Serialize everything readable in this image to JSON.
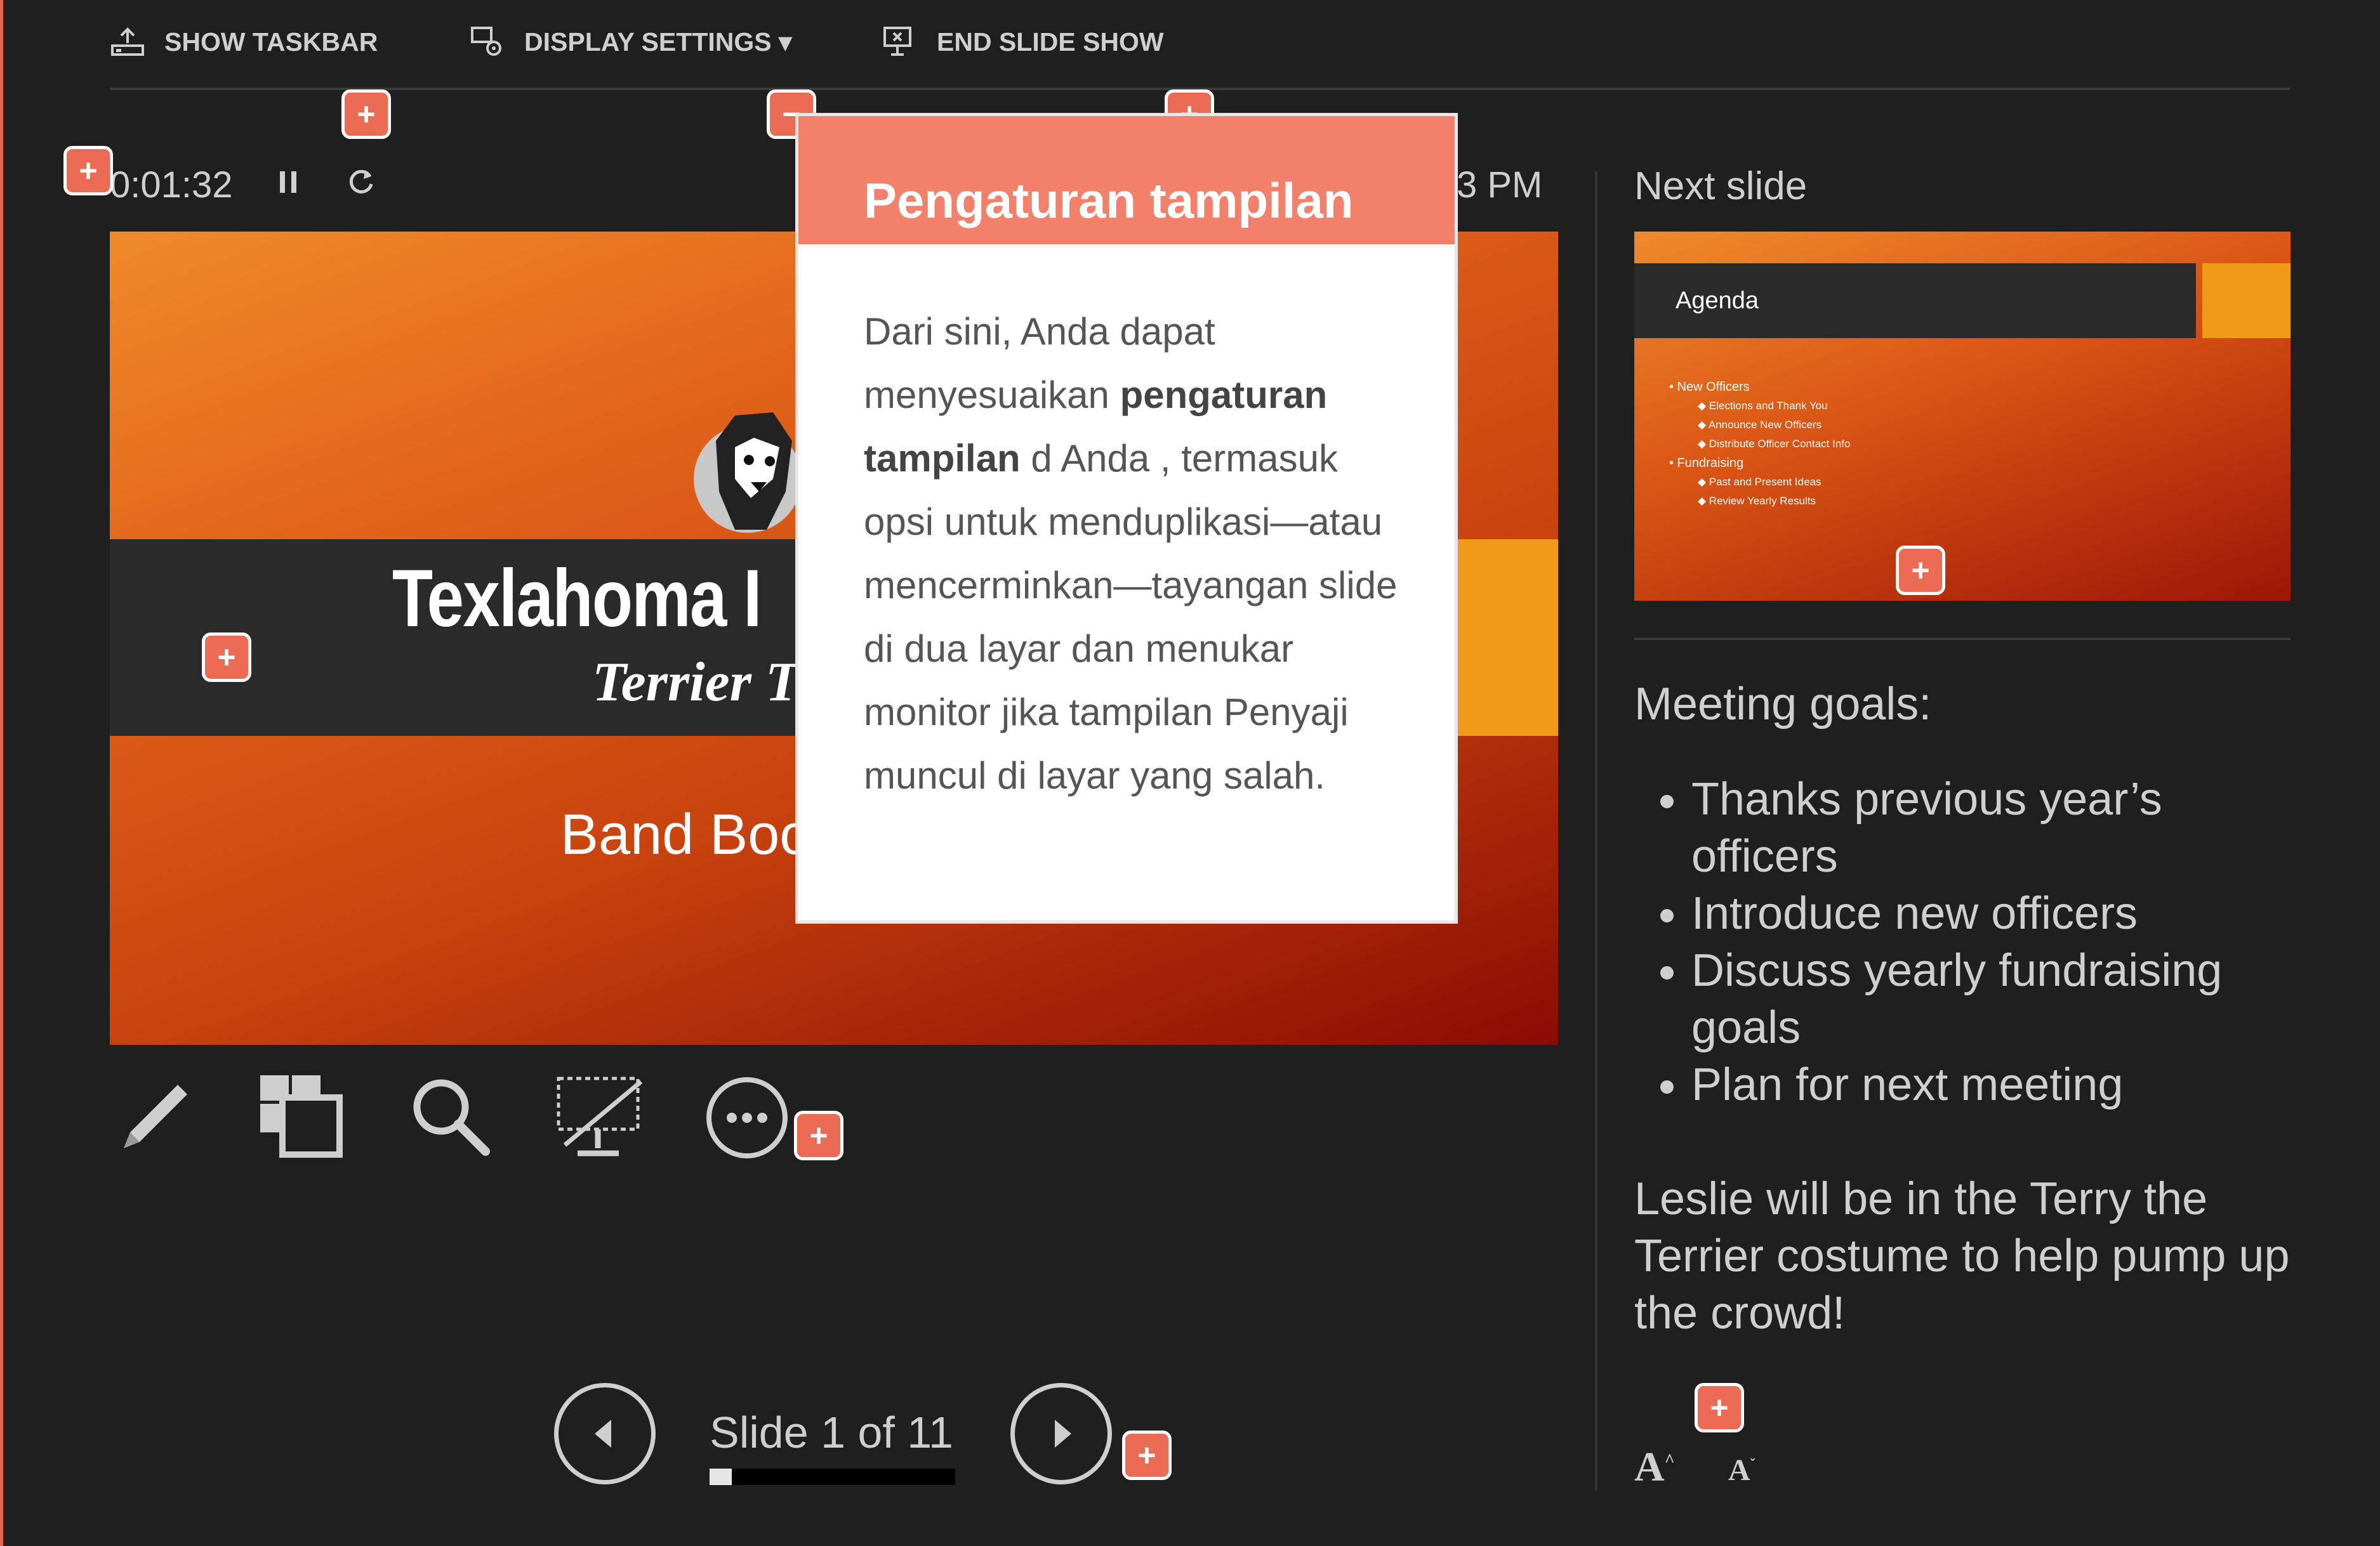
{
  "toolbar": {
    "show_taskbar": "SHOW TASKBAR",
    "display_settings": "DISPLAY SETTINGS ▾",
    "end_slide_show": "END SLIDE SHOW"
  },
  "timer": {
    "elapsed": "0:01:32",
    "clock": "3 PM"
  },
  "current_slide": {
    "title": "Texlahoma I",
    "subtitle": "Terrier T",
    "band_text": "Band Boo"
  },
  "tools": [
    "pen-icon",
    "slides-grid-icon",
    "zoom-icon",
    "black-screen-icon",
    "more-options-icon"
  ],
  "navigation": {
    "slide_label": "Slide 1 of 11",
    "progress": 0.09
  },
  "next_slide": {
    "label": "Next slide",
    "title": "Agenda",
    "bullets": [
      {
        "text": "• New Officers",
        "level": 1
      },
      {
        "text": "◆ Elections and Thank You",
        "level": 2
      },
      {
        "text": "◆ Announce New Officers",
        "level": 2
      },
      {
        "text": "◆ Distribute Officer Contact Info",
        "level": 2
      },
      {
        "text": "• Fundraising",
        "level": 1
      },
      {
        "text": "◆ Past and Present Ideas",
        "level": 2
      },
      {
        "text": "◆ Review Yearly Results",
        "level": 2
      }
    ]
  },
  "notes": {
    "heading": "Meeting goals:",
    "items": [
      "Thanks previous year’s officers",
      "Introduce new officers",
      "Discuss yearly fundraising goals",
      "Plan for next meeting"
    ],
    "closing": "Leslie will be in the Terry the Terrier costume to help pump up the crowd!"
  },
  "font_controls": {
    "increase": "A",
    "decrease": "A"
  },
  "tooltip": {
    "title": "Pengaturan tampilan",
    "part1": "Dari sini, Anda dapat menyesuaikan ",
    "bold": "pengaturan tampilan",
    "part2": " d Anda , termasuk opsi untuk menduplikasi—atau mencerminkan—tayangan slide di dua layar dan menukar monitor jika tampilan Penyaji muncul di layar yang salah."
  },
  "markers": {
    "plus": "+",
    "minus": "−"
  },
  "colors": {
    "background": "#1f1f1f",
    "accent": "#ec6b55",
    "slide_orange": "#e2641a",
    "slide_dark_red": "#8a0c03",
    "band_orange": "#f09a17"
  }
}
